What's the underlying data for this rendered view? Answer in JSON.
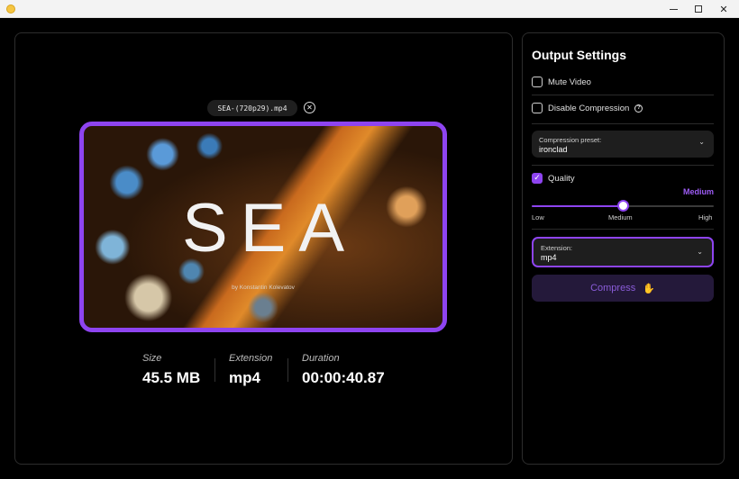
{
  "window": {
    "controls": {
      "minimize": "minimize",
      "maximize": "maximize",
      "close": "✕"
    }
  },
  "preview": {
    "filename": "SEA-(720p29).mp4",
    "clear_icon": "✕",
    "video_title": "SEA",
    "video_byline": "by Konstantin Kolevatov"
  },
  "stats": {
    "size_label": "Size",
    "size_value": "45.5 MB",
    "extension_label": "Extension",
    "extension_value": "mp4",
    "duration_label": "Duration",
    "duration_value": "00:00:40.87"
  },
  "settings": {
    "title": "Output Settings",
    "mute_video": {
      "label": "Mute Video",
      "checked": false
    },
    "disable_compression": {
      "label": "Disable Compression",
      "checked": false
    },
    "compression_preset": {
      "label": "Compression preset:",
      "value": "ironclad"
    },
    "quality": {
      "label": "Quality",
      "checked": true,
      "value_label": "Medium",
      "level": 0.5
    },
    "slider_labels": {
      "low": "Low",
      "medium": "Medium",
      "high": "High"
    },
    "extension": {
      "label": "Extension:",
      "value": "mp4"
    },
    "compress_button": "Compress",
    "compress_icon": "hand-pinch-icon"
  },
  "colors": {
    "accent": "#8e44f0",
    "quality_text": "#9d5cf5"
  }
}
